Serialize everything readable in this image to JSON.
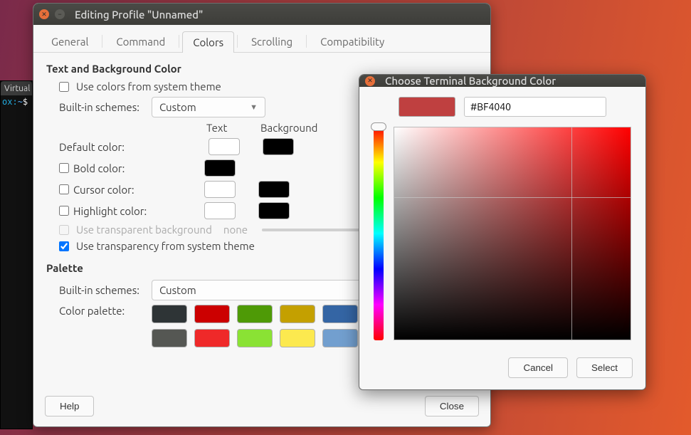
{
  "desktop": {
    "terminal_peek_tab": "Virtual",
    "terminal_prompt_host": "ox:",
    "terminal_prompt_path": "~",
    "terminal_prompt_sym": "$"
  },
  "window": {
    "title": "Editing Profile \"Unnamed\"",
    "tabs": {
      "general": "General",
      "command": "Command",
      "colors": "Colors",
      "scrolling": "Scrolling",
      "compatibility": "Compatibility"
    },
    "section_textbg": "Text and Background Color",
    "chk_system_theme": "Use colors from system theme",
    "lbl_builtin_schemes": "Built-in schemes:",
    "builtin_scheme_value": "Custom",
    "head_text": "Text",
    "head_background": "Background",
    "lbl_default_color": "Default color:",
    "lbl_bold_color": "Bold color:",
    "lbl_cursor_color": "Cursor color:",
    "lbl_highlight_color": "Highlight color:",
    "chk_transparent_bg": "Use transparent background",
    "transparent_value": "none",
    "chk_transparency_theme": "Use transparency from system theme",
    "section_palette": "Palette",
    "lbl_palette_schemes": "Built-in schemes:",
    "palette_scheme_value": "Custom",
    "lbl_color_palette": "Color palette:",
    "palette_row1": [
      "#2e3436",
      "#cc0000",
      "#4e9a06",
      "#c4a000",
      "#3465a4",
      "#75507b"
    ],
    "palette_row2": [
      "#555753",
      "#ef2929",
      "#8ae234",
      "#fce94f",
      "#729fcf",
      "#ad7fa8"
    ],
    "btn_help": "Help",
    "btn_close": "Close"
  },
  "dialog": {
    "title": "Choose Terminal Background Color",
    "hex_value": "#BF4040",
    "preview_color": "#BF4040",
    "btn_cancel": "Cancel",
    "btn_select": "Select"
  }
}
